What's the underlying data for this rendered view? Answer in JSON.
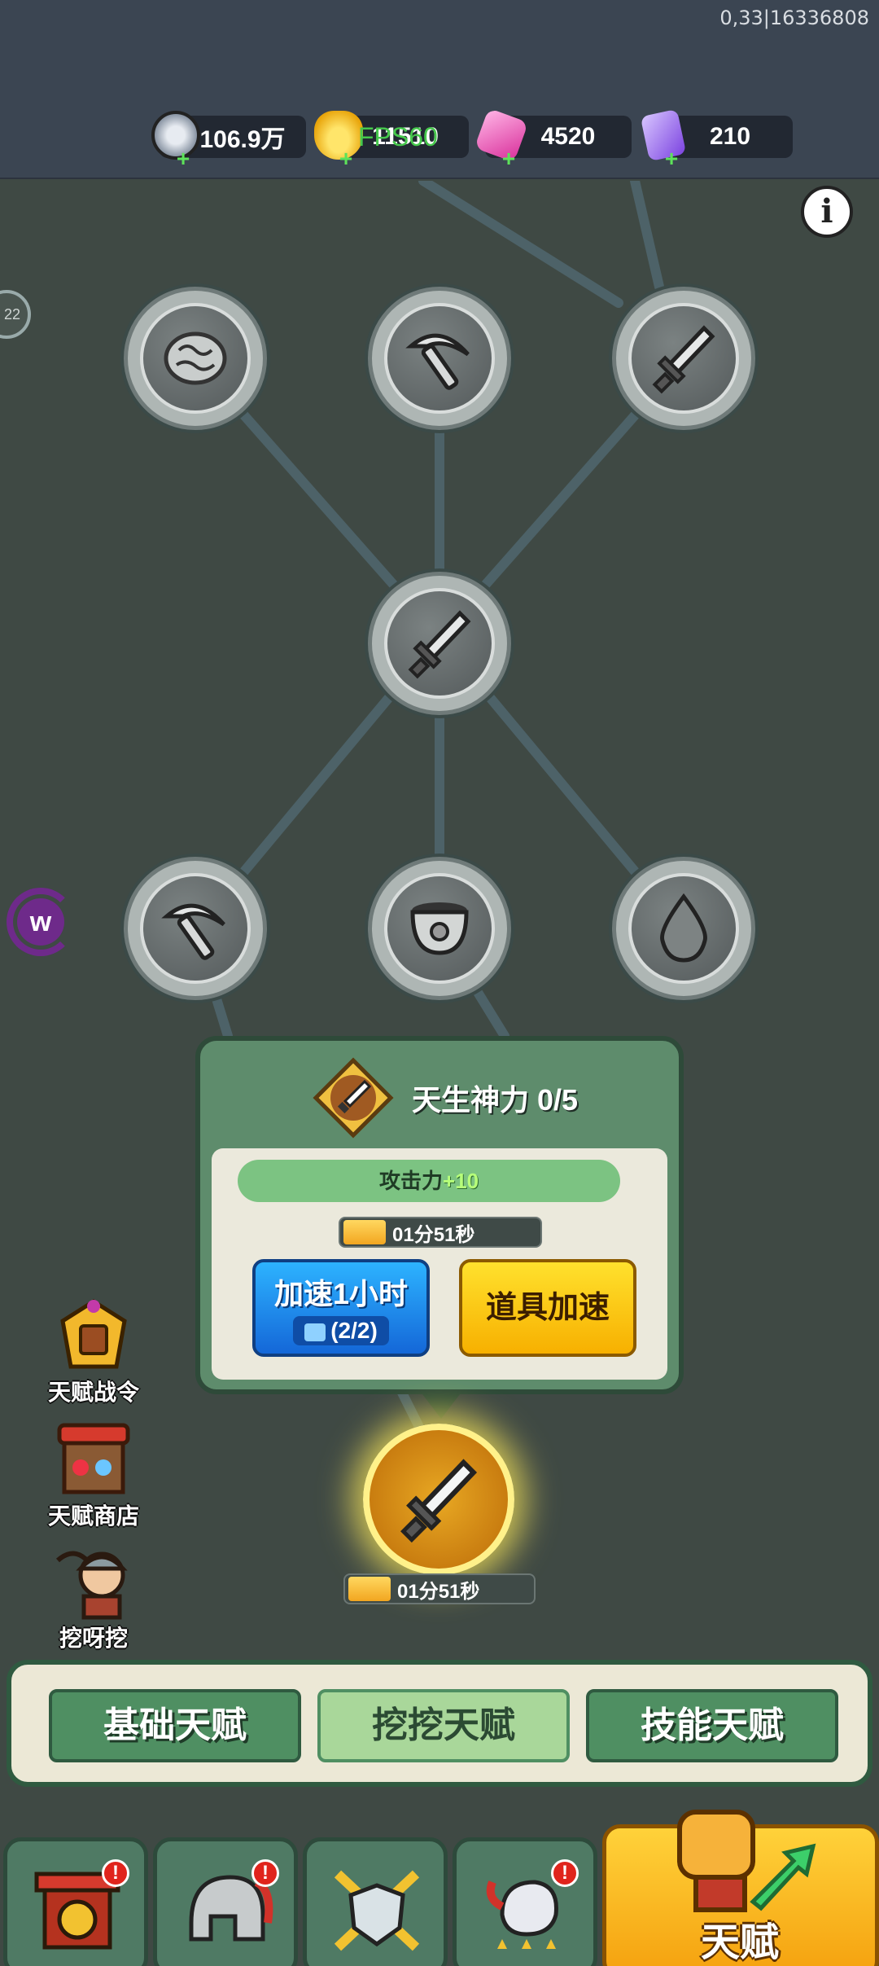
{
  "debug_text": "0,33|16336808",
  "fps_text": "FPS60",
  "resources": [
    {
      "name": "silver-coin",
      "value": "106.9万",
      "color": "#cfd6e0"
    },
    {
      "name": "gold-ingot",
      "value": "11510",
      "color": "#f6c21c"
    },
    {
      "name": "pink-gem",
      "value": "4520",
      "color": "#e85ab8"
    },
    {
      "name": "purple-crystal",
      "value": "210",
      "color": "#9b6cf0"
    }
  ],
  "tree_nodes": [
    {
      "id": "brain",
      "icon": "brain-icon",
      "locked": true
    },
    {
      "id": "pickaxe-top",
      "icon": "pickaxe-icon",
      "locked": true
    },
    {
      "id": "sword-top",
      "icon": "sword-icon",
      "locked": true
    },
    {
      "id": "sword-mid",
      "icon": "sword-icon",
      "locked": true
    },
    {
      "id": "pickaxe-bottom",
      "icon": "pickaxe-icon",
      "locked": true
    },
    {
      "id": "pot",
      "icon": "pot-icon",
      "locked": true
    },
    {
      "id": "drop",
      "icon": "drop-icon",
      "locked": true
    }
  ],
  "popup": {
    "title": "天生神力 0/5",
    "stat_label": "攻击力",
    "stat_bonus": "+10",
    "timer": "01分51秒",
    "speedup_label": "加速1小时",
    "speedup_count": "(2/2)",
    "item_speedup_label": "道具加速"
  },
  "active_node": {
    "icon": "sword-icon",
    "timer": "01分51秒"
  },
  "side_menu": [
    {
      "label": "天赋战令",
      "icon": "talent-pass-icon"
    },
    {
      "label": "天赋商店",
      "icon": "talent-shop-icon"
    },
    {
      "label": "挖呀挖",
      "icon": "miner-character-icon"
    }
  ],
  "tabs": [
    "基础天赋",
    "挖挖天赋",
    "技能天赋"
  ],
  "active_tab": 1,
  "nav": [
    {
      "icon": "gate-coin-icon",
      "badge": "!"
    },
    {
      "icon": "helmet-icon",
      "badge": "!"
    },
    {
      "icon": "crossed-swords-shield-icon",
      "badge": ""
    },
    {
      "icon": "rooster-stars-icon",
      "badge": "!"
    }
  ],
  "nav_main_label": "天赋",
  "colors": {
    "accent_green": "#5e8c6c",
    "gold": "#f6c21c",
    "background": "#3f4944"
  }
}
